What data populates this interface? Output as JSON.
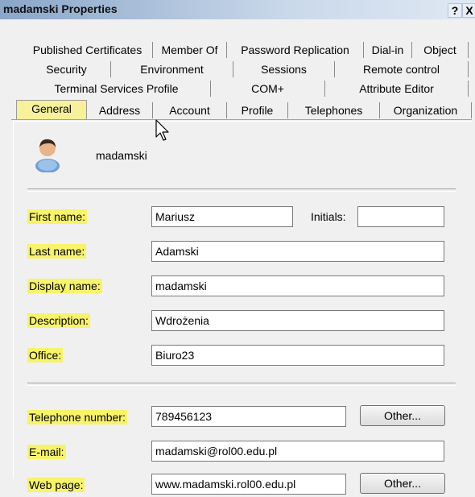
{
  "window": {
    "title": "madamski Properties",
    "help_label": "?",
    "close_label": "X"
  },
  "tabs": {
    "row1": [
      "Published Certificates",
      "Member Of",
      "Password Replication",
      "Dial-in",
      "Object"
    ],
    "row2": [
      "Security",
      "Environment",
      "Sessions",
      "Remote control"
    ],
    "row3": [
      "Terminal Services Profile",
      "COM+",
      "Attribute Editor"
    ],
    "row4": [
      "General",
      "Address",
      "Account",
      "Profile",
      "Telephones",
      "Organization"
    ],
    "active": "General"
  },
  "general": {
    "username": "madamski",
    "first_name_label": "First name:",
    "first_name_value": "Mariusz",
    "initials_label": "Initials:",
    "initials_value": "",
    "last_name_label": "Last name:",
    "last_name_value": "Adamski",
    "display_name_label": "Display name:",
    "display_name_value": "madamski",
    "description_label": "Description:",
    "description_value": "Wdrożenia",
    "office_label": "Office:",
    "office_value": "Biuro23",
    "telephone_label": "Telephone number:",
    "telephone_value": "789456123",
    "telephone_other_label": "Other...",
    "email_label": "E-mail:",
    "email_value": "madamski@rol00.edu.pl",
    "webpage_label": "Web page:",
    "webpage_value": "www.madamski.rol00.edu.pl",
    "webpage_other_label": "Other..."
  },
  "colors": {
    "highlight": "#f7f36a",
    "titlebar_start": "#8aa6c8",
    "dialog_bg": "#f0f0f0"
  }
}
